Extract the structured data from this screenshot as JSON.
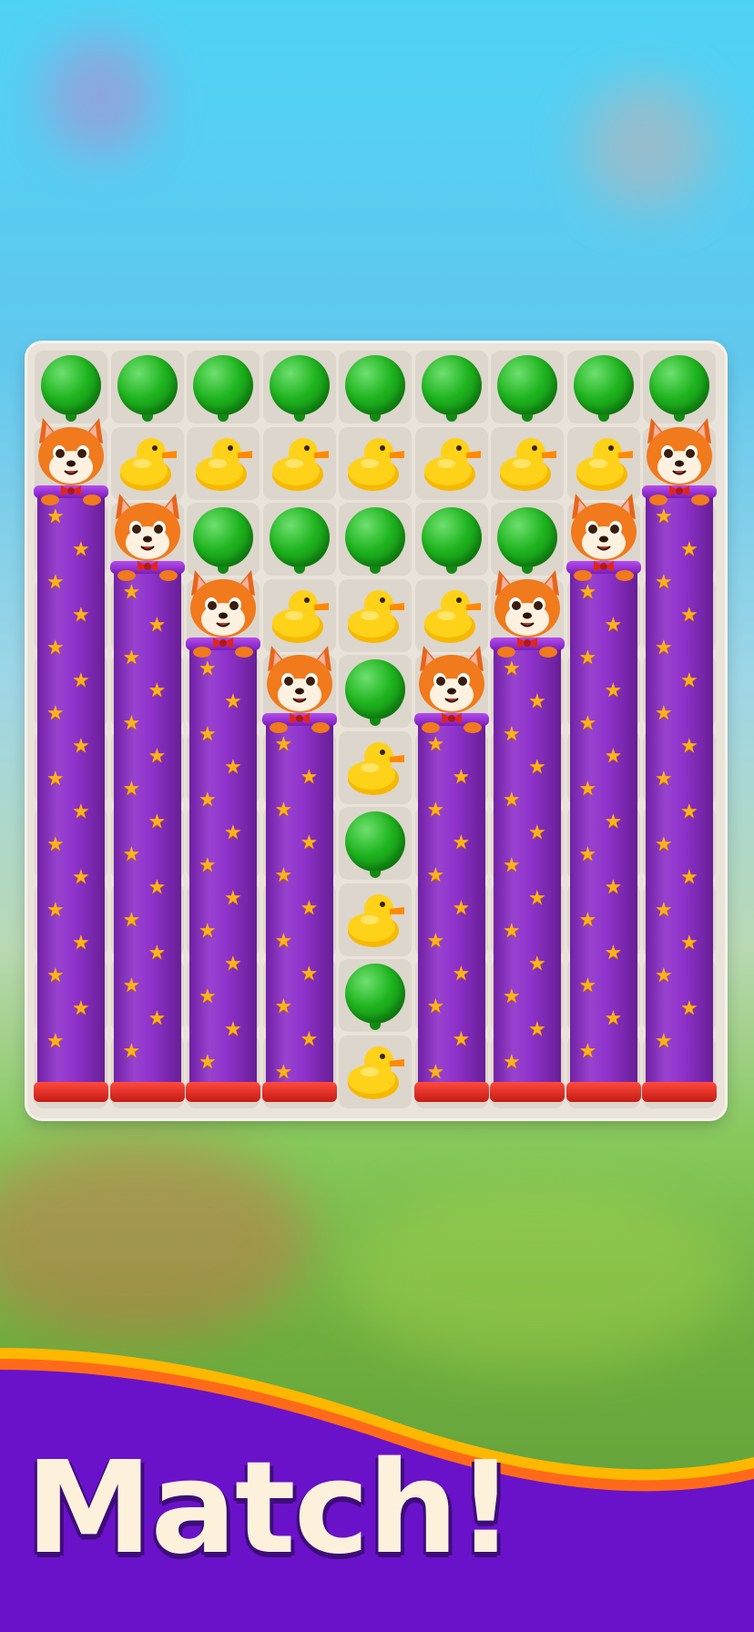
{
  "banner": {
    "title": "Match!"
  },
  "board": {
    "columns": 9,
    "pieces": [
      [
        "balloon",
        "balloon",
        "balloon",
        "balloon",
        "balloon",
        "balloon",
        "balloon",
        "balloon",
        "balloon"
      ],
      [
        "fox",
        "duck",
        "duck",
        "duck",
        "duck",
        "duck",
        "duck",
        "duck",
        "fox"
      ],
      [
        "pillar",
        "fox",
        "balloon",
        "balloon",
        "balloon",
        "balloon",
        "balloon",
        "fox",
        "pillar"
      ],
      [
        "pillar",
        "pillar",
        "fox",
        "duck",
        "duck",
        "duck",
        "fox",
        "pillar",
        "pillar"
      ],
      [
        "pillar",
        "pillar",
        "pillar",
        "fox",
        "balloon",
        "fox",
        "pillar",
        "pillar",
        "pillar"
      ],
      [
        "pillar",
        "pillar",
        "pillar",
        "pillar",
        "duck",
        "pillar",
        "pillar",
        "pillar",
        "pillar"
      ],
      [
        "pillar",
        "pillar",
        "pillar",
        "pillar",
        "balloon",
        "pillar",
        "pillar",
        "pillar",
        "pillar"
      ],
      [
        "pillar",
        "pillar",
        "pillar",
        "pillar",
        "duck",
        "pillar",
        "pillar",
        "pillar",
        "pillar"
      ],
      [
        "pillar",
        "pillar",
        "pillar",
        "pillar",
        "balloon",
        "pillar",
        "pillar",
        "pillar",
        "pillar"
      ],
      [
        "pillar",
        "pillar",
        "pillar",
        "pillar",
        "duck",
        "pillar",
        "pillar",
        "pillar",
        "pillar"
      ]
    ],
    "fox_rows_by_column": [
      1,
      2,
      3,
      4,
      null,
      4,
      3,
      2,
      1
    ]
  },
  "colors": {
    "balloon": "#1fb41f",
    "duck": "#ffd21a",
    "pillar": "#8a28c9",
    "pillar_base": "#e2261c",
    "star": "#ffb21a",
    "fox": "#f07a1c",
    "banner_purple": "#6a12c9",
    "banner_stripe": "#ffb800",
    "title_text": "#fdf1dc"
  },
  "icons": [
    "balloon-icon",
    "duck-icon",
    "fox-icon",
    "star-icon"
  ]
}
